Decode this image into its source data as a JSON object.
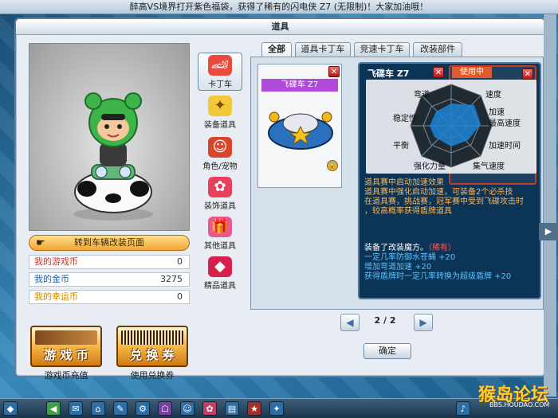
{
  "marquee": {
    "text": "醉高VS境界打开紫色福袋，获得了稀有的闪电侠 Z7 (无限制)！大家加油哦！"
  },
  "window": {
    "title": "道具"
  },
  "left_panel": {
    "go_to_garage": "转到车辆改装页面",
    "stats": [
      {
        "label": "我的游戏币",
        "value": "0",
        "color": "red"
      },
      {
        "label": "我的金币",
        "value": "3275",
        "color": "blue"
      },
      {
        "label": "我的幸运币",
        "value": "0",
        "color": "gold"
      }
    ],
    "game_coin_button": {
      "face": "",
      "text": "游 戏 币",
      "caption": "游戏币充值"
    },
    "exchange_button": {
      "face": "B 0K5674256",
      "text": "兑 换 券",
      "caption": "使用兑换券"
    }
  },
  "categories": [
    {
      "label": "卡丁车",
      "icon": "kart-icon",
      "glyph": "🏎"
    },
    {
      "label": "装备道具",
      "icon": "equip-item-icon",
      "glyph": "✦"
    },
    {
      "label": "角色/宠物",
      "icon": "character-pet-icon",
      "glyph": "☺"
    },
    {
      "label": "装饰道具",
      "icon": "decoration-icon",
      "glyph": "✿"
    },
    {
      "label": "其他道具",
      "icon": "other-items-icon",
      "glyph": "🎁"
    },
    {
      "label": "精品道具",
      "icon": "premium-gem-icon",
      "glyph": "◆"
    }
  ],
  "tabs": [
    "全部",
    "道具卡丁车",
    "竞速卡丁车",
    "改装部件"
  ],
  "item_card": {
    "name": "飞碟车 Z7"
  },
  "detail": {
    "title": "飞碟车 Z7",
    "ghost_card_label": "使用中",
    "radar_labels": [
      "弯道",
      "速度",
      "加速",
      "最高速度",
      "加速时间",
      "集气速度",
      "强化力量",
      "平衡",
      "稳定性"
    ],
    "description": [
      "道具赛中启动加速效果",
      "道具赛中强化启动加速，可装备2个必杀技",
      "在道具赛，挑战赛，冠军赛中受到飞碟攻击时",
      "，较高概率获得盾牌道具"
    ],
    "mods_header": "装备了改装魔方。",
    "mods_tag": "（稀有）",
    "mods": [
      "一定几率防御水苍蝇 +20",
      "增加弯道加速 +20",
      "获得盾牌时一定几率转换为超级盾牌 +20"
    ]
  },
  "pager": {
    "text": "2 / 2",
    "prev": "◀",
    "next": "▶"
  },
  "ok_button": "确定",
  "watermark": {
    "big": "猴岛论坛",
    "small": "BBS.HOUDAO.COM"
  }
}
